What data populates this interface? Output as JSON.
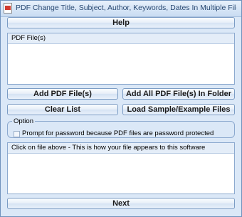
{
  "window": {
    "title": "PDF Change Title, Subject, Author, Keywords, Dates In Multiple Files Soft..."
  },
  "buttons": {
    "help": "Help",
    "add_pdf_files": "Add PDF File(s)",
    "add_all_in_folder": "Add All PDF File(s) In Folder",
    "clear_list": "Clear List",
    "load_sample": "Load Sample/Example Files",
    "next": "Next"
  },
  "file_list": {
    "header": "PDF File(s)"
  },
  "option": {
    "legend": "Option",
    "password_checkbox_label": "Prompt for password because PDF files are password protected",
    "password_checked": false
  },
  "preview": {
    "header": "Click on file above - This is how your file appears to this software"
  }
}
